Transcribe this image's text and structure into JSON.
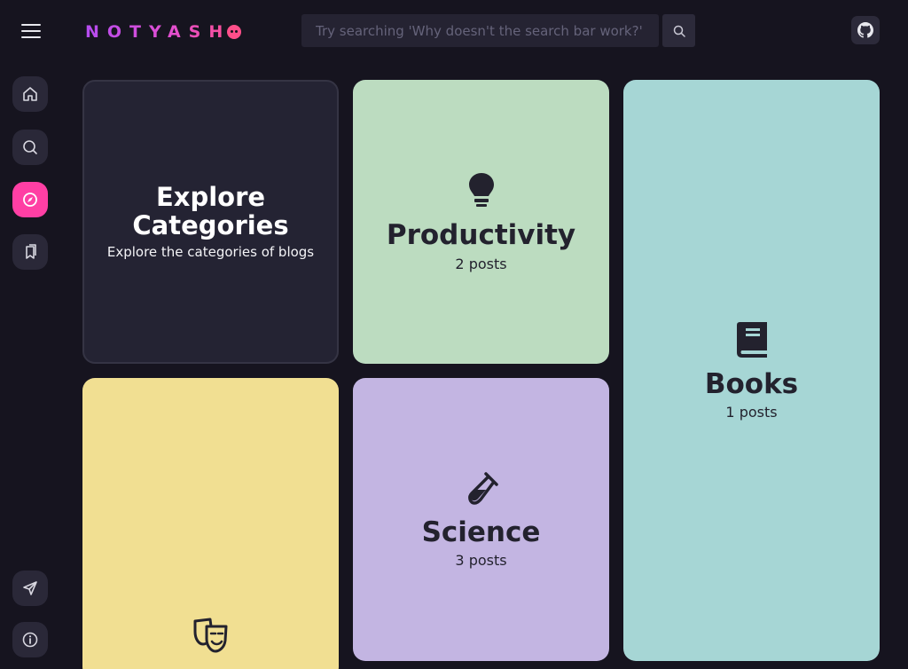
{
  "header": {
    "logo_text": "NOTYASH",
    "search_placeholder": "Try searching 'Why doesn't the search bar work?'"
  },
  "icons": {
    "menu": "hamburger-menu-icon",
    "search": "search-icon",
    "github": "github-icon",
    "home": "home-icon",
    "explore": "compass-icon",
    "bookmarks": "bookmarks-icon",
    "send": "send-icon",
    "info": "info-icon"
  },
  "colors": {
    "background": "#16141f",
    "accent": "#ff3fa4",
    "productivity": "#bcdcc0",
    "books": "#a6d6d5",
    "science": "#c3b5e2",
    "entertainment": "#f1df92"
  },
  "explore_card": {
    "title": "Explore Categories",
    "subtitle": "Explore the categories of blogs"
  },
  "categories": [
    {
      "name": "Productivity",
      "posts": "2 posts",
      "icon": "lightbulb-icon"
    },
    {
      "name": "Books",
      "posts": "1 posts",
      "icon": "book-icon"
    },
    {
      "name": "Science",
      "posts": "3 posts",
      "icon": "test-tube-icon"
    },
    {
      "name": "",
      "posts": "",
      "icon": "theater-masks-icon"
    }
  ]
}
